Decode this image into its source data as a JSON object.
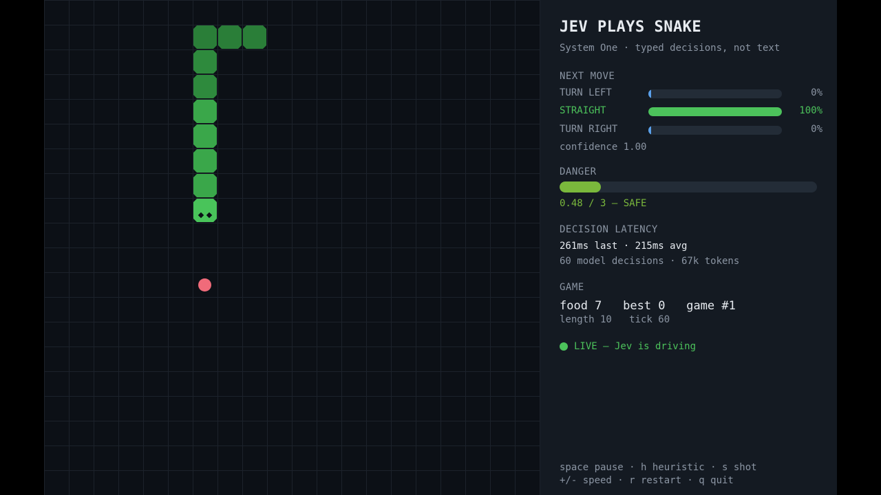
{
  "colors": {
    "background": "#0c1016",
    "panel": "#141a22",
    "snake": "#3aa74a",
    "snake_head": "#49c45a",
    "food": "#f06b7a",
    "accent_green": "#4cc25b",
    "danger_fill": "#7ab83c",
    "tick_blue": "#5aa0ea"
  },
  "board": {
    "snake_direction": "down",
    "snake_cells": 10
  },
  "panel": {
    "title": "JEV PLAYS SNAKE",
    "subtitle": "System One · typed decisions, not text",
    "next_move": {
      "heading": "NEXT MOVE",
      "options": [
        {
          "label": "TURN LEFT",
          "percent_text": "0%",
          "value": 0
        },
        {
          "label": "STRAIGHT",
          "percent_text": "100%",
          "value": 1.0
        },
        {
          "label": "TURN RIGHT",
          "percent_text": "0%",
          "value": 0
        }
      ],
      "confidence": "confidence 1.00"
    },
    "danger": {
      "heading": "DANGER",
      "value": 0.48,
      "max": 3,
      "text": "0.48 / 3 — SAFE"
    },
    "latency": {
      "heading": "DECISION LATENCY",
      "line1": "261ms last · 215ms avg",
      "line2": "60 model decisions · 67k tokens"
    },
    "game": {
      "heading": "GAME",
      "stats": "food 7   best 0   game #1",
      "sub": "length 10   tick 60"
    },
    "live": "LIVE — Jev is driving",
    "keys": {
      "line1": "space pause · h heuristic · s shot",
      "line2": "+/- speed · r restart · q quit"
    }
  }
}
